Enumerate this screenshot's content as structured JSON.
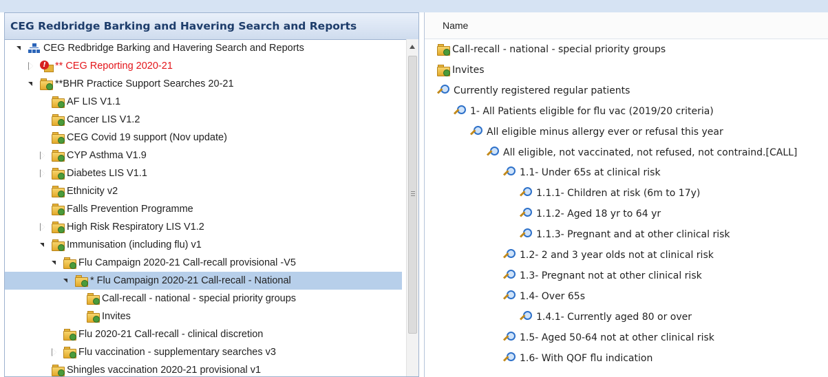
{
  "left_panel": {
    "title": "CEG Redbridge Barking and Havering Search and Reports",
    "tree": [
      {
        "label": "CEG Redbridge Barking and Havering Search and Reports",
        "icon": "network-icon",
        "expander": "open"
      },
      {
        "label": "** CEG Reporting 2020-21",
        "icon": "warning-folder-icon",
        "expander": "closed",
        "color": "#e3151a"
      },
      {
        "label": "**BHR Practice Support Searches 20-21",
        "icon": "folder-icon",
        "expander": "open"
      },
      {
        "label": "AF LIS V1.1",
        "icon": "folder-icon",
        "expander": "none"
      },
      {
        "label": "Cancer LIS V1.2",
        "icon": "folder-icon",
        "expander": "none"
      },
      {
        "label": "CEG Covid 19 support (Nov update)",
        "icon": "folder-icon",
        "expander": "none"
      },
      {
        "label": "CYP Asthma V1.9",
        "icon": "folder-icon",
        "expander": "closed"
      },
      {
        "label": "Diabetes LIS V1.1",
        "icon": "folder-icon",
        "expander": "closed"
      },
      {
        "label": "Ethnicity v2",
        "icon": "folder-icon",
        "expander": "none"
      },
      {
        "label": "Falls Prevention Programme",
        "icon": "folder-icon",
        "expander": "none"
      },
      {
        "label": "High Risk Respiratory LIS V1.2",
        "icon": "folder-icon",
        "expander": "closed"
      },
      {
        "label": "Immunisation (including flu) v1",
        "icon": "folder-icon",
        "expander": "open"
      },
      {
        "label": "Flu Campaign 2020-21 Call-recall provisional -V5",
        "icon": "folder-icon",
        "expander": "open"
      },
      {
        "label": "* Flu Campaign 2020-21 Call-recall - National",
        "icon": "folder-icon",
        "expander": "open",
        "selected": true
      },
      {
        "label": "Call-recall - national - special priority groups",
        "icon": "folder-icon",
        "expander": "none"
      },
      {
        "label": "Invites",
        "icon": "folder-icon",
        "expander": "none"
      },
      {
        "label": "Flu 2020-21 Call-recall - clinical discretion",
        "icon": "folder-icon",
        "expander": "none"
      },
      {
        "label": "Flu vaccination - supplementary searches v3",
        "icon": "folder-icon",
        "expander": "closed"
      },
      {
        "label": "Shingles vaccination 2020-21 provisional v1",
        "icon": "folder-icon",
        "expander": "none"
      }
    ]
  },
  "right_panel": {
    "column_header": "Name",
    "items": [
      {
        "label": "Call-recall - national - special priority groups",
        "icon": "folder-icon"
      },
      {
        "label": "Invites",
        "icon": "folder-icon"
      },
      {
        "label": "Currently registered regular patients",
        "icon": "search-icon"
      },
      {
        "label": "1- All Patients eligible for flu vac (2019/20 criteria)",
        "icon": "search-icon"
      },
      {
        "label": "All eligible minus allergy ever or refusal this year",
        "icon": "search-icon"
      },
      {
        "label": "All eligible, not vaccinated, not refused, not contraind.[CALL]",
        "icon": "search-icon"
      },
      {
        "label": "1.1- Under 65s at clinical risk",
        "icon": "search-icon"
      },
      {
        "label": "1.1.1- Children at risk (6m to 17y)",
        "icon": "search-icon"
      },
      {
        "label": "1.1.2- Aged 18 yr to 64 yr",
        "icon": "search-icon"
      },
      {
        "label": "1.1.3- Pregnant and at other clinical risk",
        "icon": "search-icon"
      },
      {
        "label": "1.2- 2 and 3 year olds not at clinical risk",
        "icon": "search-icon"
      },
      {
        "label": "1.3- Pregnant not at other clinical risk",
        "icon": "search-icon"
      },
      {
        "label": "1.4- Over 65s",
        "icon": "search-icon"
      },
      {
        "label": "1.4.1- Currently aged 80 or over",
        "icon": "search-icon"
      },
      {
        "label": "1.5- Aged 50-64 not at other clinical risk",
        "icon": "search-icon"
      },
      {
        "label": "1.6- With QOF flu indication",
        "icon": "search-icon"
      }
    ]
  }
}
